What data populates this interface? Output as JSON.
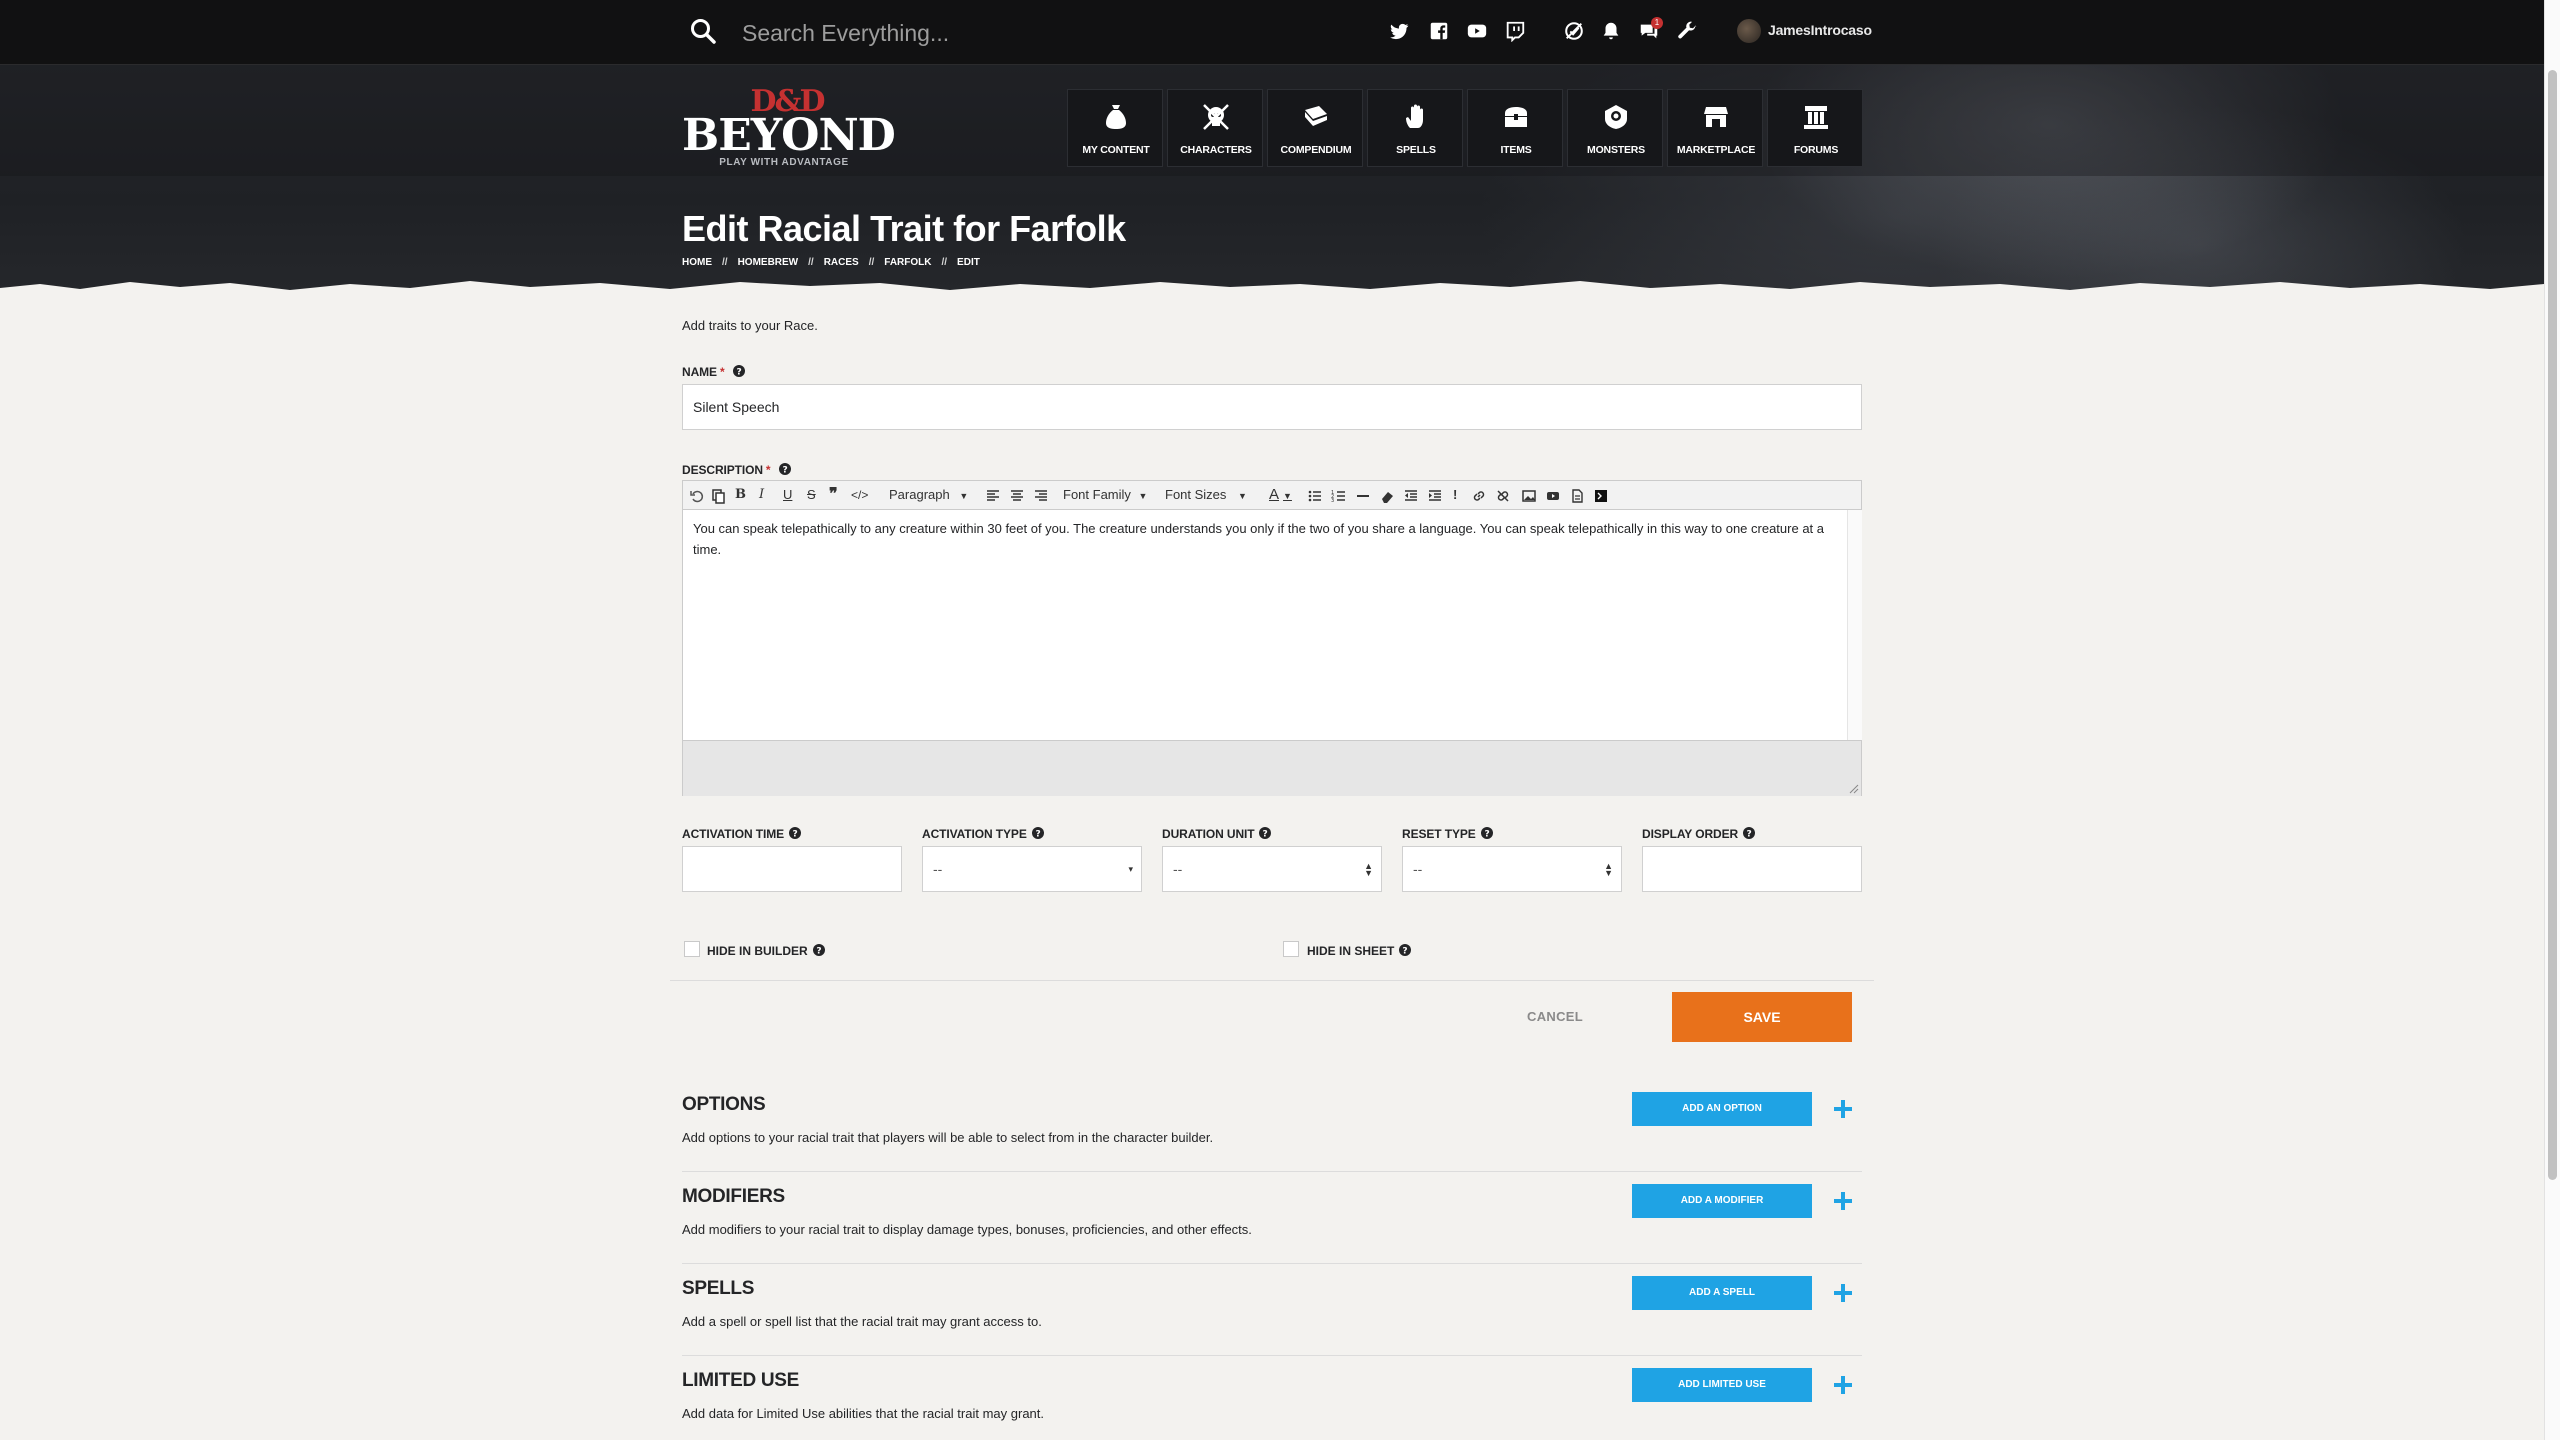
{
  "search": {
    "placeholder": "Search Everything..."
  },
  "topbar": {
    "icons": [
      "twitter-icon",
      "facebook-icon",
      "youtube-icon",
      "twitch-icon",
      "no-ads-icon",
      "bell-icon",
      "chat-icon",
      "wrench-icon"
    ],
    "chat_badge": "1",
    "username": "JamesIntrocaso"
  },
  "logo": {
    "mark": "D&D",
    "name": "BEYOND",
    "tagline": "PLAY WITH ADVANTAGE"
  },
  "nav": [
    {
      "label": "MY CONTENT",
      "icon": "bag-icon"
    },
    {
      "label": "CHARACTERS",
      "icon": "skull-icon"
    },
    {
      "label": "COMPENDIUM",
      "icon": "book-icon"
    },
    {
      "label": "SPELLS",
      "icon": "hand-icon"
    },
    {
      "label": "ITEMS",
      "icon": "chest-icon"
    },
    {
      "label": "MONSTERS",
      "icon": "monster-icon"
    },
    {
      "label": "MARKETPLACE",
      "icon": "shop-icon"
    },
    {
      "label": "FORUMS",
      "icon": "forum-icon"
    }
  ],
  "page": {
    "title": "Edit Racial Trait for Farfolk",
    "breadcrumb": [
      "HOME",
      "HOMEBREW",
      "RACES",
      "FARFOLK",
      "EDIT"
    ],
    "breadcrumb_sep": "//"
  },
  "form": {
    "intro": "Add traits to your Race.",
    "name_label": "NAME",
    "name_value": "Silent Speech",
    "description_label": "DESCRIPTION",
    "required_mark": "*",
    "toolbar": {
      "paragraph": "Paragraph",
      "font_family": "Font Family",
      "font_sizes": "Font Sizes",
      "text_color": "A"
    },
    "description_value": "You can speak telepathically to any creature within 30 feet of you. The creature understands you only if the two of you share a language. You can speak telepathically in this way to one creature at a time.",
    "activation_time_label": "ACTIVATION TIME",
    "activation_time_value": "",
    "activation_type_label": "ACTIVATION TYPE",
    "activation_type_value": "--",
    "duration_unit_label": "DURATION UNIT",
    "duration_unit_value": "--",
    "reset_type_label": "RESET TYPE",
    "reset_type_value": "--",
    "display_order_label": "DISPLAY ORDER",
    "display_order_value": "",
    "hide_in_builder_label": "HIDE IN BUILDER",
    "hide_in_sheet_label": "HIDE IN SHEET",
    "cancel_label": "CANCEL",
    "save_label": "SAVE"
  },
  "sections": [
    {
      "title": "OPTIONS",
      "desc": "Add options to your racial trait that players will be able to select from in the character builder.",
      "button": "ADD AN OPTION"
    },
    {
      "title": "MODIFIERS",
      "desc": "Add modifiers to your racial trait to display damage types, bonuses, proficiencies, and other effects.",
      "button": "ADD A MODIFIER"
    },
    {
      "title": "SPELLS",
      "desc": "Add a spell or spell list that the racial trait may grant access to.",
      "button": "ADD A SPELL"
    },
    {
      "title": "LIMITED USE",
      "desc": "Add data for Limited Use abilities that the racial trait may grant.",
      "button": "ADD LIMITED USE"
    }
  ],
  "colors": {
    "accent_orange": "#e8711b",
    "accent_blue": "#1fa3e4",
    "required_red": "#c53131",
    "topbar": "#111112"
  }
}
